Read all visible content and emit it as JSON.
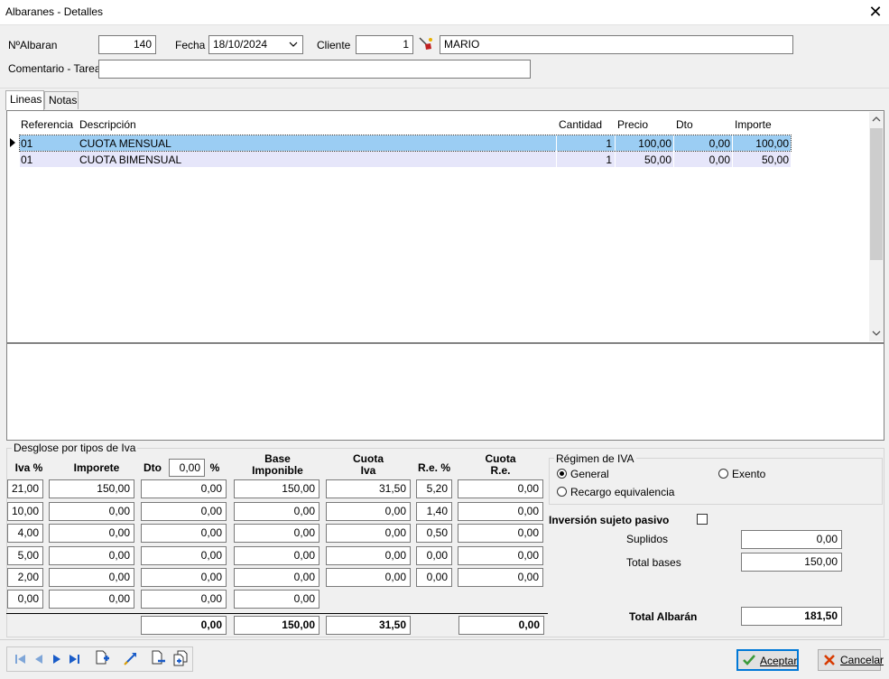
{
  "window": {
    "title": "Albaranes - Detalles",
    "close_glyph": "✕"
  },
  "header": {
    "albaran_label": "NºAlbaran",
    "albaran_value": "140",
    "fecha_label": "Fecha",
    "fecha_value": "18/10/2024",
    "cliente_label": "Cliente",
    "cliente_id": "1",
    "cliente_name": "MARIO",
    "comentario_label": "Comentario - Tarea",
    "comentario_value": ""
  },
  "tabs": [
    {
      "label": "Lineas"
    },
    {
      "label": "Notas"
    }
  ],
  "grid": {
    "columns": [
      "Referencia",
      "Descripción",
      "Cantidad",
      "Precio",
      "Dto",
      "Importe"
    ],
    "rows": [
      {
        "referencia": "01",
        "descripcion": "CUOTA MENSUAL",
        "cantidad": "1",
        "precio": "100,00",
        "dto": "0,00",
        "importe": "100,00"
      },
      {
        "referencia": "01",
        "descripcion": "CUOTA BIMENSUAL",
        "cantidad": "1",
        "precio": "50,00",
        "dto": "0,00",
        "importe": "50,00"
      }
    ]
  },
  "desglose": {
    "title": "Desglose por tipos de Iva",
    "headers": {
      "iva": "Iva %",
      "importe": "Imporete",
      "dto": "Dto",
      "dto_value": "0,00",
      "pct": "%",
      "base_1": "Base",
      "base_2": "Imponible",
      "cuota_1": "Cuota",
      "cuota_2": "Iva",
      "re": "R.e. %",
      "cre_1": "Cuota",
      "cre_2": "R.e."
    },
    "rows": [
      {
        "iva": "21,00",
        "importe": "150,00",
        "dto": "0,00",
        "base": "150,00",
        "cuota": "31,50",
        "re": "5,20",
        "cuota_re": "0,00"
      },
      {
        "iva": "10,00",
        "importe": "0,00",
        "dto": "0,00",
        "base": "0,00",
        "cuota": "0,00",
        "re": "1,40",
        "cuota_re": "0,00"
      },
      {
        "iva": "4,00",
        "importe": "0,00",
        "dto": "0,00",
        "base": "0,00",
        "cuota": "0,00",
        "re": "0,50",
        "cuota_re": "0,00"
      },
      {
        "iva": "5,00",
        "importe": "0,00",
        "dto": "0,00",
        "base": "0,00",
        "cuota": "0,00",
        "re": "0,00",
        "cuota_re": "0,00"
      },
      {
        "iva": "2,00",
        "importe": "0,00",
        "dto": "0,00",
        "base": "0,00",
        "cuota": "0,00",
        "re": "0,00",
        "cuota_re": "0,00"
      },
      {
        "iva": "0,00",
        "importe": "0,00",
        "dto": "0,00",
        "base": "0,00"
      }
    ],
    "totals": {
      "dto": "0,00",
      "base": "150,00",
      "cuota": "31,50",
      "cuota_re": "0,00"
    }
  },
  "regimen": {
    "title": "Régimen de IVA",
    "options": [
      {
        "label": "General",
        "selected": true
      },
      {
        "label": "Exento",
        "selected": false
      },
      {
        "label": "Recargo equivalencia",
        "selected": false
      }
    ],
    "inversion_label": "Inversión sujeto pasivo",
    "inversion_checked": false
  },
  "summary": {
    "suplidos_label": "Suplidos",
    "suplidos_value": "0,00",
    "total_bases_label": "Total bases",
    "total_bases_value": "150,00",
    "total_albaran_label": "Total Albarán",
    "total_albaran_value": "181,50"
  },
  "footer": {
    "accept_label": "Aceptar",
    "cancel_label": "Cancelar"
  },
  "colors": {
    "selected_row": "#9bcdf3",
    "alt_row": "#e6e6fa",
    "accent": "#0078d7",
    "cancel_red": "#d83b01",
    "accept_green": "#3a9a3a"
  }
}
